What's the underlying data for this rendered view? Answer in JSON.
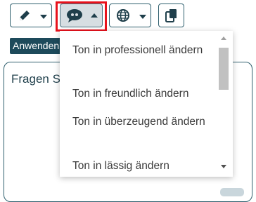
{
  "toolbar": {
    "buttons": [
      {
        "icon": "pencil-icon",
        "state": "closed"
      },
      {
        "icon": "speech-bubble-icon",
        "state": "open"
      },
      {
        "icon": "globe-icon",
        "state": "closed"
      },
      {
        "icon": "copy-icon"
      }
    ]
  },
  "apply_button_label": "Anwenden",
  "input": {
    "label": "Fragen Sie"
  },
  "tone_menu": {
    "items": [
      "Ton in professionell ändern",
      "Ton in freundlich ändern",
      "Ton in überzeugend ändern",
      "Ton in lässig ändern"
    ]
  },
  "colors": {
    "accent": "#1d4a5b",
    "highlight": "#e8121c",
    "active_button_bg": "#d7dee2"
  }
}
